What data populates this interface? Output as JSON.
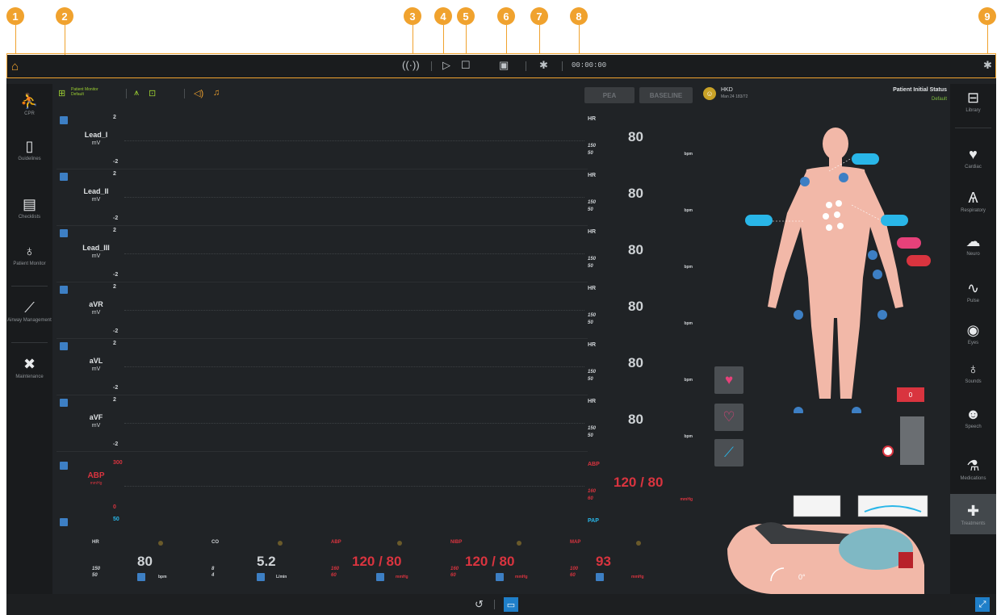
{
  "callouts": [
    "1",
    "2",
    "3",
    "4",
    "5",
    "6",
    "7",
    "8",
    "9"
  ],
  "topbar": {
    "timer": "00:00:00",
    "icons": [
      "home-icon",
      "antenna-icon",
      "play-icon",
      "stop-icon",
      "save-icon",
      "bluetooth-icon"
    ]
  },
  "left_nav": [
    {
      "label": "CPR",
      "icon": "cpr-icon"
    },
    {
      "label": "Guidelines",
      "icon": "tablet-icon"
    },
    {
      "label": "Checklists",
      "icon": "clipboard-icon"
    },
    {
      "label": "Patient Monitor",
      "icon": "monitor-icon"
    },
    {
      "label": "Airway Management",
      "icon": "airway-icon"
    },
    {
      "label": "Maintenance",
      "icon": "tools-icon"
    }
  ],
  "monitor_toolbar": {
    "label_line1": "Patient Monitor",
    "label_line2": "Default"
  },
  "buttons": {
    "pea": "PEA",
    "baseline": "BASELINE"
  },
  "waves": [
    {
      "label": "Lead_I",
      "unit": "mV",
      "max": "2",
      "min": "-2",
      "param": "HR",
      "value": "80",
      "hi": "150",
      "lo": "50",
      "punit": "bpm"
    },
    {
      "label": "Lead_II",
      "unit": "mV",
      "max": "2",
      "min": "-2",
      "param": "HR",
      "value": "80",
      "hi": "150",
      "lo": "50",
      "punit": "bpm"
    },
    {
      "label": "Lead_III",
      "unit": "mV",
      "max": "2",
      "min": "-2",
      "param": "HR",
      "value": "80",
      "hi": "150",
      "lo": "50",
      "punit": "bpm"
    },
    {
      "label": "aVR",
      "unit": "mV",
      "max": "2",
      "min": "-2",
      "param": "HR",
      "value": "80",
      "hi": "150",
      "lo": "50",
      "punit": "bpm"
    },
    {
      "label": "aVL",
      "unit": "mV",
      "max": "2",
      "min": "-2",
      "param": "HR",
      "value": "80",
      "hi": "150",
      "lo": "50",
      "punit": "bpm"
    },
    {
      "label": "aVF",
      "unit": "mV",
      "max": "2",
      "min": "-2",
      "param": "HR",
      "value": "80",
      "hi": "150",
      "lo": "50",
      "punit": "bpm"
    },
    {
      "label": "ABP",
      "unit": "mmHg",
      "max": "300",
      "min": "0",
      "param": "ABP",
      "value": "120 / 80",
      "hi": "160",
      "lo": "60",
      "punit": "mmHg"
    },
    {
      "label": "",
      "unit": "",
      "max": "50",
      "min": "",
      "param": "PAP",
      "value": "",
      "hi": "",
      "lo": "",
      "punit": ""
    }
  ],
  "tiles": [
    {
      "param": "HR",
      "value": "80",
      "hi": "150",
      "lo": "50",
      "unit": "bpm"
    },
    {
      "param": "CO",
      "value": "5.2",
      "hi": "8",
      "lo": "4",
      "unit": "L/min"
    },
    {
      "param": "ABP",
      "value": "120 / 80",
      "hi": "160",
      "lo": "60",
      "unit": "mmHg"
    },
    {
      "param": "NIBP",
      "value": "120 / 80",
      "hi": "160",
      "lo": "60",
      "unit": "mmHg"
    },
    {
      "param": "MAP",
      "value": "93",
      "hi": "100",
      "lo": "60",
      "unit": "mmHg"
    }
  ],
  "patient": {
    "name": "HKD",
    "info": "Man 24 183/72",
    "status_title": "Patient Initial Status",
    "status_value": "Default",
    "angle": "0°",
    "marker": "0"
  },
  "right_nav": [
    {
      "label": "Library",
      "icon": "library-icon"
    },
    {
      "label": "Cardiac",
      "icon": "heart-icon"
    },
    {
      "label": "Respiratory",
      "icon": "lungs-icon"
    },
    {
      "label": "Neuro",
      "icon": "brain-icon"
    },
    {
      "label": "Pulse",
      "icon": "pulse-icon"
    },
    {
      "label": "Eyes",
      "icon": "eye-icon"
    },
    {
      "label": "Sounds",
      "icon": "stethoscope-icon"
    },
    {
      "label": "Speech",
      "icon": "speech-icon"
    },
    {
      "label": "Medications",
      "icon": "medication-icon"
    },
    {
      "label": "Treatments",
      "icon": "treatment-icon"
    }
  ],
  "colors": {
    "accent": "#f0a22e",
    "monitor_bg": "#202326",
    "blue": "#3d7fc4",
    "red": "#d9343f",
    "cyan": "#29b6e8",
    "green": "#7fbf3f"
  }
}
